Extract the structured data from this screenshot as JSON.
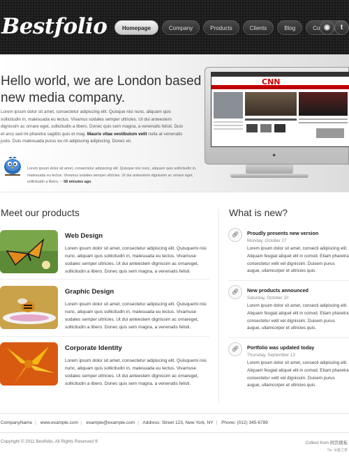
{
  "header": {
    "logo": "Bestfolio",
    "nav": [
      "Homepage",
      "Company",
      "Products",
      "Clients",
      "Blog",
      "Contact us"
    ],
    "social": [
      {
        "icon": "rss-icon",
        "glyph": "◉"
      },
      {
        "icon": "twitter-icon",
        "glyph": "t"
      }
    ]
  },
  "hero": {
    "title_line1": "Hello world, we are London based",
    "title_line2": "new media company.",
    "text_before_bold": "Lorem ipsum dolor sit amet, consectetur adipiscing elit. Quisque nisi nunc, aliquam quis sollicitudin in, malesuada eu lectus. Vivamus sodales semper ultricies. Ut dui anteestem dignissim ac ornare eget, sollicitudin a libero. Donec quis sem magna, a venenatis felisti. Duis et arcu sed mi pharetra sagittis quis et mag. ",
    "text_bold": "Mauris vitae vestibulum velit",
    "text_after_bold": " nulla at venenatis justo. Duis malesuada purus eu mi adipiscing adipiscing. Donec eii.",
    "tweet": "Lorem ipsum dolor sit amet, consectetur adipiscing elit. Quisque nisi nunc, aliquam quis sollicitudin in, malesuada eu lectus. Vivamus sodales semper ultricies. Ut dui anteestem dignissim ac ornare eget, sollicitudin a libero. -- ",
    "tweet_time": "58 minutes ago",
    "monitor_logo": "CNN"
  },
  "products": {
    "title": "Meet our products",
    "items": [
      {
        "title": "Web Design",
        "text": "Lorem ipsum dolor sit amet, consectetur adipiscing elit. Quisquemi nisi nunc, aliquam quis sollicitudin in, malesuada eu lectus. Vivamuse sodales semper ultricies. Ut dui anteestem dignissim ac ornareget, sollicitudin a libero. Donec quis sem magna, a venenatis felisti."
      },
      {
        "title": "Graphic Design",
        "text": "Lorem ipsum dolor sit amet, consectetur adipiscing elit. Quisquemi nisi nunc, aliquam quis sollicitudin in, malesuada eu lectus. Vivamuse sodales semper ultricies. Ut dui anteestem dignissim ac ornareget, sollicitudin a libero. Donec quis sem magna, a venenatis felisti."
      },
      {
        "title": "Corporate Identity",
        "text": "Lorem ipsum dolor sit amet, consectetur adipiscing elit. Quisquemi nisi nunc, aliquam quis sollicitudin in, malesuada eu lectus. Vivamuse sodales semper ultricies. Ut dui anteestem dignissim ac ornareget, sollicitudin a libero. Donec quis sem magna, a venenatis felisti."
      }
    ]
  },
  "news": {
    "title": "What is new?",
    "items": [
      {
        "title": "Proudly presents new version",
        "date": "Monday, October 27",
        "text": "Lorem ipsum dolor sit amet, consecti adipiscing elit. Aliquam feugiat aliquet elit in comod. Etiam pharetra consectetur velit vel dignissim. Duisem purus augue, ullamcorper et ultricies quis."
      },
      {
        "title": "New products announced",
        "date": "Saturday, October 10",
        "text": "Lorem ipsum dolor sit amet, consecti adipiscing elit. Aliquam feugiat aliquet elit in comod. Etiam pharetra consectetur velit vel dignissim. Duisem purus augue, ullamcorper et ultricies quis."
      },
      {
        "title": "Portfolio was updated today",
        "date": "Thursday, September 13",
        "text": "Lorem ipsum dolor sit amet, consecti adipiscing elit. Aliquam feugiat aliquet elit in comod. Etiam pharetra consectetur velit vel dignissim. Duisem purus augue, ullamcorper et ultricies quis."
      }
    ]
  },
  "footer": {
    "contact": [
      "CompanyName",
      "www.example.com",
      "example@example.com",
      "Address: Street 123, New York, NY",
      "Phone: (012) 345-6789"
    ],
    "copyright": "Copyright © 2011 Bestfolio, All Rights Reserved ®",
    "collect": "Collect from 网页模板",
    "tip": "Tip: 设备之家"
  }
}
